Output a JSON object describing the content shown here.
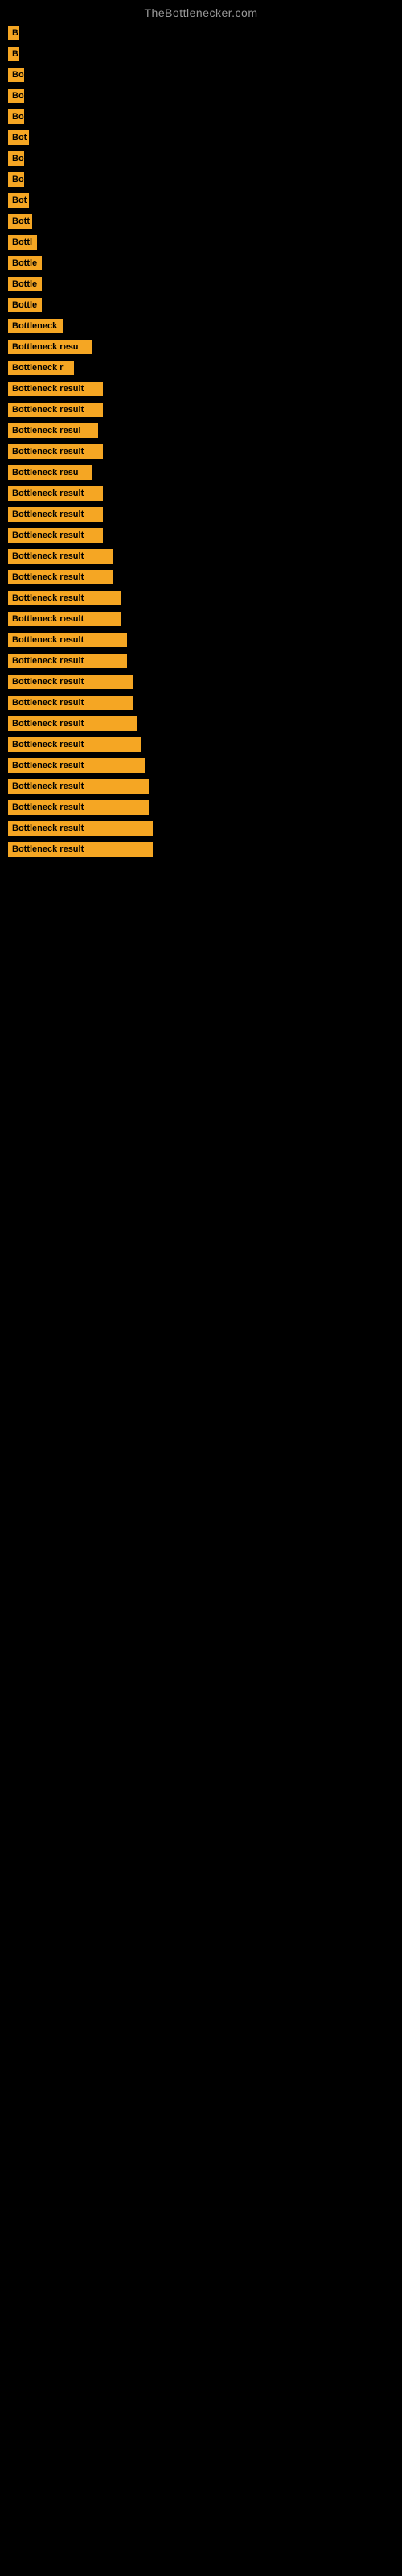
{
  "site": {
    "title": "TheBottlenecker.com"
  },
  "labels": [
    {
      "text": "B",
      "width": 14
    },
    {
      "text": "B",
      "width": 14
    },
    {
      "text": "Bo",
      "width": 20
    },
    {
      "text": "Bo",
      "width": 20
    },
    {
      "text": "Bo",
      "width": 20
    },
    {
      "text": "Bot",
      "width": 26
    },
    {
      "text": "Bo",
      "width": 20
    },
    {
      "text": "Bo",
      "width": 20
    },
    {
      "text": "Bot",
      "width": 26
    },
    {
      "text": "Bott",
      "width": 30
    },
    {
      "text": "Bottl",
      "width": 36
    },
    {
      "text": "Bottle",
      "width": 42
    },
    {
      "text": "Bottle",
      "width": 42
    },
    {
      "text": "Bottle",
      "width": 42
    },
    {
      "text": "Bottleneck",
      "width": 68
    },
    {
      "text": "Bottleneck resu",
      "width": 105
    },
    {
      "text": "Bottleneck r",
      "width": 82
    },
    {
      "text": "Bottleneck result",
      "width": 118
    },
    {
      "text": "Bottleneck result",
      "width": 118
    },
    {
      "text": "Bottleneck resul",
      "width": 112
    },
    {
      "text": "Bottleneck result",
      "width": 118
    },
    {
      "text": "Bottleneck resu",
      "width": 105
    },
    {
      "text": "Bottleneck result",
      "width": 118
    },
    {
      "text": "Bottleneck result",
      "width": 118
    },
    {
      "text": "Bottleneck result",
      "width": 118
    },
    {
      "text": "Bottleneck result",
      "width": 130
    },
    {
      "text": "Bottleneck result",
      "width": 130
    },
    {
      "text": "Bottleneck result",
      "width": 140
    },
    {
      "text": "Bottleneck result",
      "width": 140
    },
    {
      "text": "Bottleneck result",
      "width": 148
    },
    {
      "text": "Bottleneck result",
      "width": 148
    },
    {
      "text": "Bottleneck result",
      "width": 155
    },
    {
      "text": "Bottleneck result",
      "width": 155
    },
    {
      "text": "Bottleneck result",
      "width": 160
    },
    {
      "text": "Bottleneck result",
      "width": 165
    },
    {
      "text": "Bottleneck result",
      "width": 170
    },
    {
      "text": "Bottleneck result",
      "width": 175
    },
    {
      "text": "Bottleneck result",
      "width": 175
    },
    {
      "text": "Bottleneck result",
      "width": 180
    },
    {
      "text": "Bottleneck result",
      "width": 180
    }
  ]
}
